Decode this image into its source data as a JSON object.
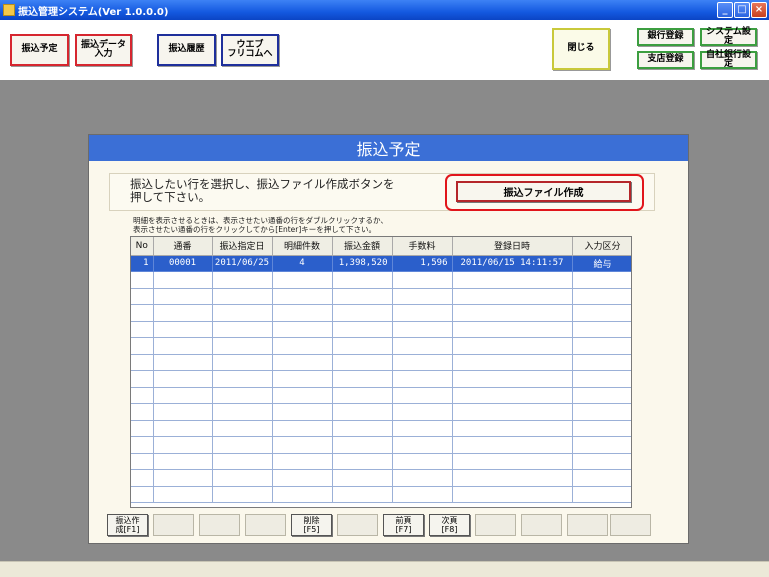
{
  "window": {
    "title": "振込管理システム(Ver 1.0.0.0)",
    "minimize": "_",
    "maximize": "□",
    "close": "×"
  },
  "toolbar": {
    "furikomi_yotei": "振込予定",
    "data_input": "振込データ\n入力",
    "rireki": "振込履歴",
    "web": "ウエブ\nフリコムへ",
    "close": "閉じる",
    "ginko_toroku": "銀行登録",
    "system_settei": "システム設定",
    "shiten_toroku": "支店登録",
    "jisha_ginko": "自社銀行設定"
  },
  "dialog": {
    "title": "振込予定",
    "instruction": "振込したい行を選択し、振込ファイル作成ボタンを\n押して下さい。",
    "create_button": "振込ファイル作成",
    "table_note": "明細を表示させるときは、表示させたい通番の行をダブルクリックするか、\n表示させたい通番の行をクリックしてから[Enter]キーを押して下さい。"
  },
  "table": {
    "headers": [
      "No",
      "通番",
      "振込指定日",
      "明細件数",
      "振込金額",
      "手数料",
      "登録日時",
      "入力区分"
    ],
    "rows": [
      [
        "1",
        "00001",
        "2011/06/25",
        "4",
        "1,398,520",
        "1,596",
        "2011/06/15 14:11:57",
        "給与"
      ]
    ]
  },
  "fkeys": {
    "create": "振込作\n成[F1]",
    "delete": "削除\n[F5]",
    "prev": "前頁\n[F7]",
    "next": "次頁\n[F8]"
  }
}
